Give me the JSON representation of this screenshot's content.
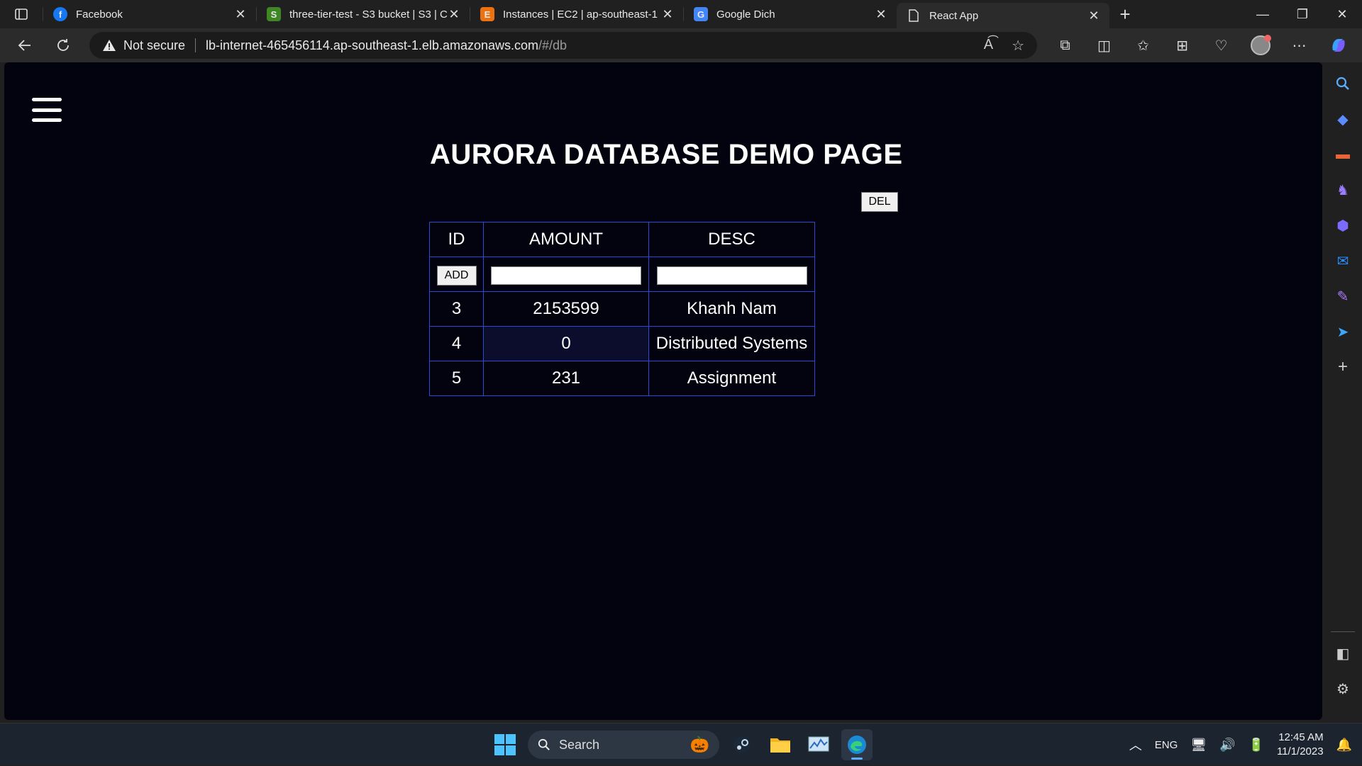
{
  "browser": {
    "tabs": [
      {
        "title": "Facebook",
        "icon": "facebook-icon",
        "color": "#1877f2",
        "glyph": "f",
        "active": false
      },
      {
        "title": "three-tier-test - S3 bucket | S3 | C",
        "icon": "s3-icon",
        "color": "#3f8624",
        "glyph": "S",
        "active": false
      },
      {
        "title": "Instances | EC2 | ap-southeast-1",
        "icon": "ec2-icon",
        "color": "#ec7211",
        "glyph": "E",
        "active": false
      },
      {
        "title": "Google Dich",
        "icon": "google-translate-icon",
        "color": "#4285f4",
        "glyph": "G",
        "active": false
      },
      {
        "title": "React App",
        "icon": "page-icon",
        "color": "#2b2b2b",
        "glyph": "▯",
        "active": true
      }
    ],
    "address": {
      "security": "Not secure",
      "url_main": "lb-internet-465456114.ap-southeast-1.elb.amazonaws.com",
      "url_path": "/#/db"
    }
  },
  "page": {
    "title": "AURORA DATABASE DEMO PAGE",
    "del_label": "DEL",
    "add_label": "ADD",
    "columns": [
      "ID",
      "AMOUNT",
      "DESC"
    ],
    "rows": [
      {
        "id": "3",
        "amount": "2153599",
        "desc": "Khanh Nam"
      },
      {
        "id": "4",
        "amount": "0",
        "desc": "Distributed Systems"
      },
      {
        "id": "5",
        "amount": "231",
        "desc": "Assignment"
      }
    ]
  },
  "taskbar": {
    "search_label": "Search",
    "language": "ENG",
    "time": "12:45 AM",
    "date": "11/1/2023"
  }
}
